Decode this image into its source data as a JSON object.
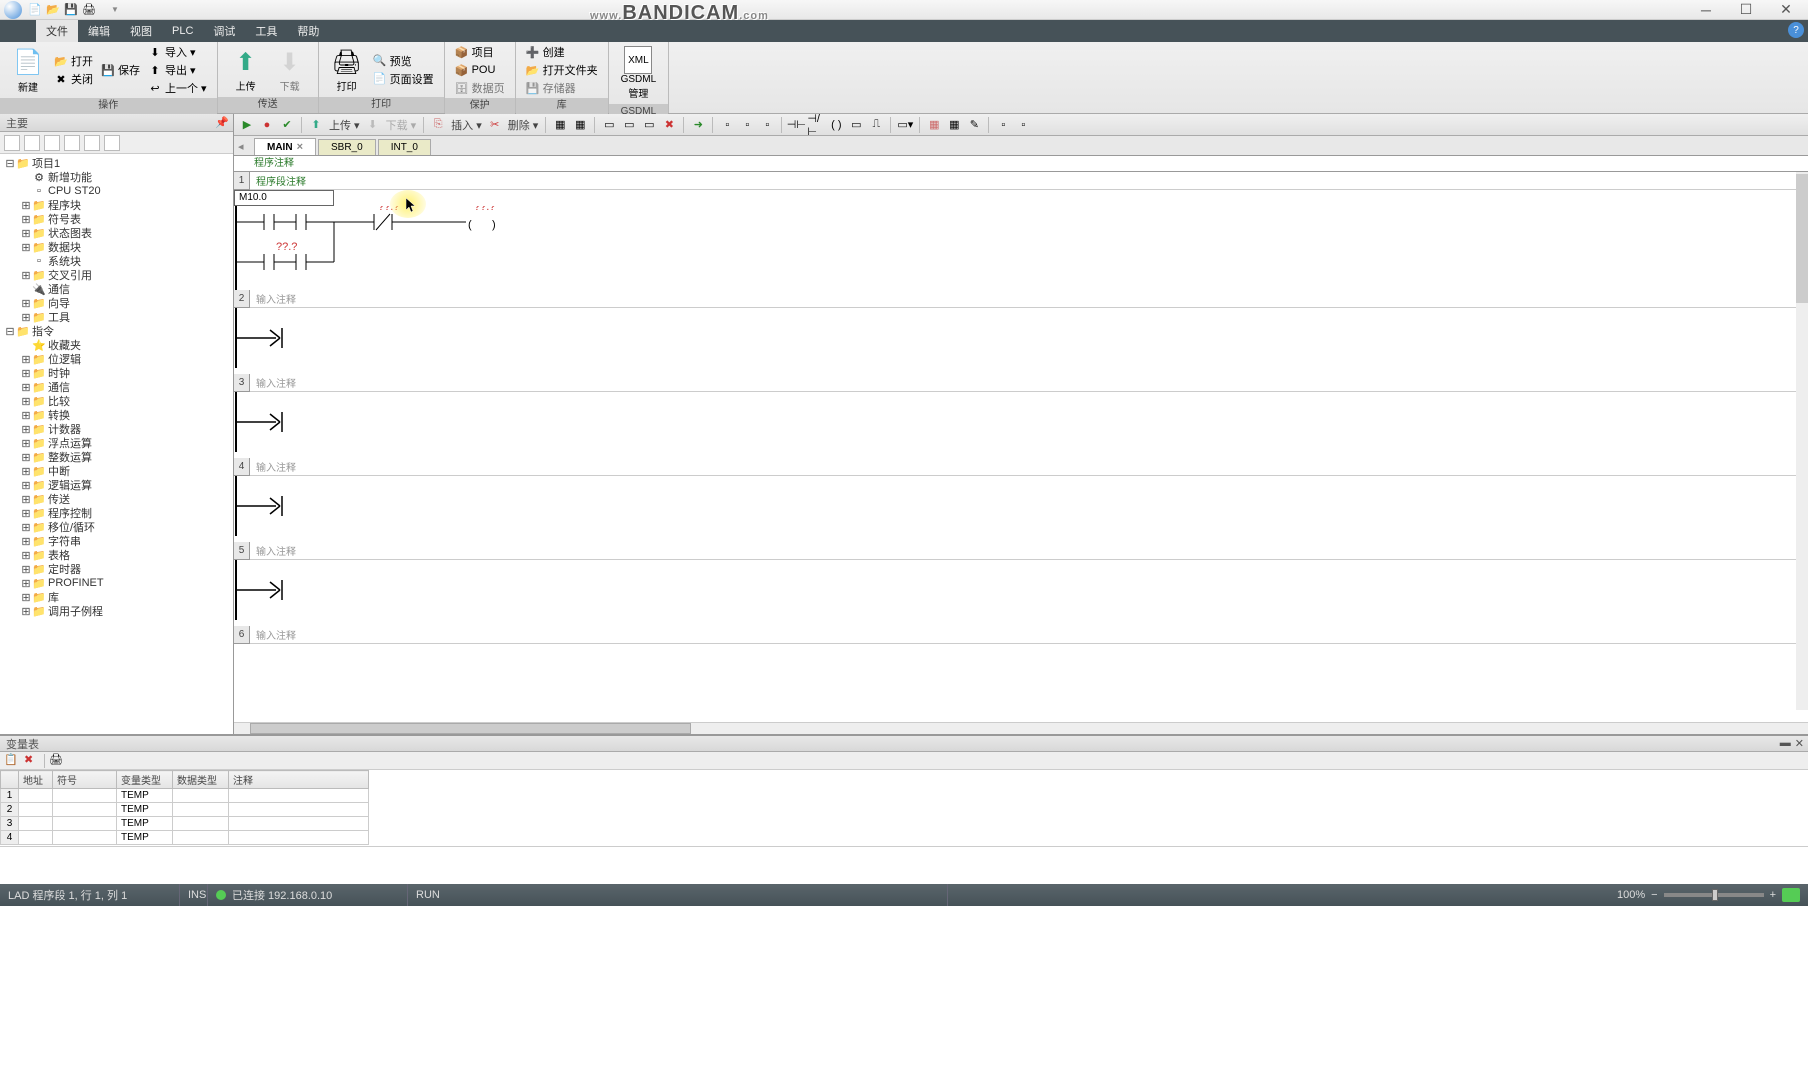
{
  "watermark": {
    "prefix": "www.",
    "main": "BANDICAM",
    "suffix": ".com"
  },
  "qat": [
    "new",
    "open",
    "save",
    "print"
  ],
  "titlebar": {
    "text": ""
  },
  "menu": {
    "items": [
      "文件",
      "编辑",
      "视图",
      "PLC",
      "调试",
      "工具",
      "帮助"
    ],
    "active_index": 0
  },
  "ribbon": {
    "groups": [
      {
        "label": "操作",
        "big": [
          {
            "icon": "📄",
            "label": "新建"
          }
        ],
        "cols": [
          [
            {
              "icon": "📂",
              "label": "打开"
            },
            {
              "icon": "✖",
              "label": "关闭"
            }
          ],
          [
            {
              "icon": "💾",
              "label": "保存",
              "dd": true
            }
          ],
          [
            {
              "icon": "⬇",
              "label": "导入 ▾"
            },
            {
              "icon": "⬆",
              "label": "导出 ▾"
            },
            {
              "icon": "↩",
              "label": "上一个 ▾"
            }
          ]
        ]
      },
      {
        "label": "传送",
        "big": [
          {
            "icon": "⬆",
            "label": "上传",
            "color": "#3a8"
          },
          {
            "icon": "⬇",
            "label": "下载",
            "color": "#bbb",
            "disabled": true
          }
        ]
      },
      {
        "label": "打印",
        "big": [
          {
            "icon": "🖨",
            "label": "打印"
          }
        ],
        "cols": [
          [
            {
              "icon": "🔍",
              "label": "预览"
            },
            {
              "icon": "📄",
              "label": "页面设置"
            }
          ]
        ]
      },
      {
        "label": "保护",
        "cols": [
          [
            {
              "icon": "📦",
              "label": "项目"
            },
            {
              "icon": "📦",
              "label": "POU"
            },
            {
              "icon": "🗄",
              "label": "数据页",
              "disabled": true
            }
          ]
        ]
      },
      {
        "label": "库",
        "cols": [
          [
            {
              "icon": "➕",
              "label": "创建"
            },
            {
              "icon": "📂",
              "label": "打开文件夹"
            },
            {
              "icon": "💾",
              "label": "存储器",
              "disabled": true
            }
          ]
        ]
      },
      {
        "label": "GSDML",
        "big": [
          {
            "icon": "XML",
            "label": "GSDML\n管理",
            "xml": true
          }
        ]
      }
    ]
  },
  "tree": {
    "title": "主要",
    "toolbar_count": 6,
    "nodes": [
      {
        "d": 0,
        "t": "-",
        "i": "📁",
        "l": "项目1"
      },
      {
        "d": 1,
        "t": " ",
        "i": "⚙",
        "l": "新增功能"
      },
      {
        "d": 1,
        "t": " ",
        "i": "▫",
        "l": "CPU ST20"
      },
      {
        "d": 1,
        "t": "+",
        "i": "📁",
        "l": "程序块"
      },
      {
        "d": 1,
        "t": "+",
        "i": "📁",
        "l": "符号表"
      },
      {
        "d": 1,
        "t": "+",
        "i": "📁",
        "l": "状态图表"
      },
      {
        "d": 1,
        "t": "+",
        "i": "📁",
        "l": "数据块"
      },
      {
        "d": 1,
        "t": " ",
        "i": "▫",
        "l": "系统块"
      },
      {
        "d": 1,
        "t": "+",
        "i": "📁",
        "l": "交叉引用"
      },
      {
        "d": 1,
        "t": " ",
        "i": "🔌",
        "l": "通信"
      },
      {
        "d": 1,
        "t": "+",
        "i": "📁",
        "l": "向导"
      },
      {
        "d": 1,
        "t": "+",
        "i": "📁",
        "l": "工具"
      },
      {
        "d": 0,
        "t": "-",
        "i": "📁",
        "l": "指令"
      },
      {
        "d": 1,
        "t": " ",
        "i": "⭐",
        "l": "收藏夹"
      },
      {
        "d": 1,
        "t": "+",
        "i": "📁",
        "l": "位逻辑"
      },
      {
        "d": 1,
        "t": "+",
        "i": "📁",
        "l": "时钟"
      },
      {
        "d": 1,
        "t": "+",
        "i": "📁",
        "l": "通信"
      },
      {
        "d": 1,
        "t": "+",
        "i": "📁",
        "l": "比较"
      },
      {
        "d": 1,
        "t": "+",
        "i": "📁",
        "l": "转换"
      },
      {
        "d": 1,
        "t": "+",
        "i": "📁",
        "l": "计数器"
      },
      {
        "d": 1,
        "t": "+",
        "i": "📁",
        "l": "浮点运算"
      },
      {
        "d": 1,
        "t": "+",
        "i": "📁",
        "l": "整数运算"
      },
      {
        "d": 1,
        "t": "+",
        "i": "📁",
        "l": "中断"
      },
      {
        "d": 1,
        "t": "+",
        "i": "📁",
        "l": "逻辑运算"
      },
      {
        "d": 1,
        "t": "+",
        "i": "📁",
        "l": "传送"
      },
      {
        "d": 1,
        "t": "+",
        "i": "📁",
        "l": "程序控制"
      },
      {
        "d": 1,
        "t": "+",
        "i": "📁",
        "l": "移位/循环"
      },
      {
        "d": 1,
        "t": "+",
        "i": "📁",
        "l": "字符串"
      },
      {
        "d": 1,
        "t": "+",
        "i": "📁",
        "l": "表格"
      },
      {
        "d": 1,
        "t": "+",
        "i": "📁",
        "l": "定时器"
      },
      {
        "d": 1,
        "t": "+",
        "i": "📁",
        "l": "PROFINET"
      },
      {
        "d": 1,
        "t": "+",
        "i": "📁",
        "l": "库"
      },
      {
        "d": 1,
        "t": "+",
        "i": "📁",
        "l": "调用子例程"
      }
    ]
  },
  "editor_toolbar": {
    "items": [
      {
        "type": "btn",
        "name": "run",
        "glyph": "▶",
        "color": "#2a8a2a"
      },
      {
        "type": "btn",
        "name": "stop",
        "glyph": "●",
        "color": "#c33"
      },
      {
        "type": "btn",
        "name": "compile",
        "glyph": "✔",
        "color": "#2a8a2a"
      },
      {
        "type": "sep"
      },
      {
        "type": "btn",
        "name": "upload-arrow",
        "glyph": "⬆",
        "color": "#3a8"
      },
      {
        "type": "text",
        "label": "上传",
        "dd": true
      },
      {
        "type": "btn",
        "name": "download-arrow",
        "glyph": "⬇",
        "color": "#bbb"
      },
      {
        "type": "text",
        "label": "下载",
        "dd": true,
        "disabled": true
      },
      {
        "type": "sep"
      },
      {
        "type": "btn",
        "name": "insert-icon",
        "glyph": "⎘",
        "color": "#c66"
      },
      {
        "type": "text",
        "label": "插入",
        "dd": true
      },
      {
        "type": "btn",
        "name": "delete-icon",
        "glyph": "✂",
        "color": "#c33"
      },
      {
        "type": "text",
        "label": "删除",
        "dd": true
      },
      {
        "type": "sep"
      },
      {
        "type": "btn",
        "name": "tb1",
        "glyph": "▦"
      },
      {
        "type": "btn",
        "name": "tb2",
        "glyph": "▦"
      },
      {
        "type": "sep"
      },
      {
        "type": "btn",
        "name": "tb3",
        "glyph": "▭"
      },
      {
        "type": "btn",
        "name": "tb4",
        "glyph": "▭"
      },
      {
        "type": "btn",
        "name": "tb5",
        "glyph": "▭"
      },
      {
        "type": "btn",
        "name": "tb6",
        "glyph": "✖",
        "color": "#c33"
      },
      {
        "type": "sep"
      },
      {
        "type": "btn",
        "name": "tb7",
        "glyph": "➜",
        "color": "#2a8a2a"
      },
      {
        "type": "sep"
      },
      {
        "type": "btn",
        "name": "tb8",
        "glyph": "▫"
      },
      {
        "type": "btn",
        "name": "tb9",
        "glyph": "▫"
      },
      {
        "type": "btn",
        "name": "tb10",
        "glyph": "▫"
      },
      {
        "type": "sep"
      },
      {
        "type": "btn",
        "name": "contact-no",
        "glyph": "⊣⊢"
      },
      {
        "type": "btn",
        "name": "contact-nc",
        "glyph": "⊣/⊢"
      },
      {
        "type": "btn",
        "name": "coil",
        "glyph": "( )"
      },
      {
        "type": "btn",
        "name": "box",
        "glyph": "▭"
      },
      {
        "type": "btn",
        "name": "branch",
        "glyph": "⎍"
      },
      {
        "type": "sep"
      },
      {
        "type": "btn",
        "name": "tb-a",
        "glyph": "▭",
        "dd": true
      },
      {
        "type": "sep"
      },
      {
        "type": "btn",
        "name": "tb-b",
        "glyph": "▦",
        "color": "#c66"
      },
      {
        "type": "btn",
        "name": "tb-c",
        "glyph": "▦"
      },
      {
        "type": "btn",
        "name": "tb-d",
        "glyph": "✎"
      },
      {
        "type": "sep"
      },
      {
        "type": "btn",
        "name": "tb-e",
        "glyph": "▫"
      },
      {
        "type": "btn",
        "name": "tb-f",
        "glyph": "▫"
      }
    ]
  },
  "tabs": [
    {
      "label": "MAIN",
      "active": true,
      "close": true
    },
    {
      "label": "SBR_0"
    },
    {
      "label": "INT_0"
    }
  ],
  "program_comment": "程序注释",
  "networks": [
    {
      "num": "1",
      "comment": "程序段注释",
      "green": true,
      "has_addr": true,
      "addr": "M10.0",
      "kind": "full"
    },
    {
      "num": "2",
      "comment": "输入注释",
      "kind": "empty"
    },
    {
      "num": "3",
      "comment": "输入注释",
      "kind": "empty"
    },
    {
      "num": "4",
      "comment": "输入注释",
      "kind": "empty"
    },
    {
      "num": "5",
      "comment": "输入注释",
      "kind": "empty"
    },
    {
      "num": "6",
      "comment": "输入注释",
      "kind": "stub"
    }
  ],
  "unk_label": "??.?",
  "var_panel": {
    "title": "变量表",
    "headers": [
      "",
      "地址",
      "符号",
      "变量类型",
      "数据类型",
      "注释"
    ],
    "rows": [
      {
        "n": "1",
        "type": "TEMP"
      },
      {
        "n": "2",
        "type": "TEMP"
      },
      {
        "n": "3",
        "type": "TEMP"
      },
      {
        "n": "4",
        "type": "TEMP"
      }
    ]
  },
  "status": {
    "pos": "LAD 程序段 1, 行 1, 列 1",
    "ins": "INS",
    "conn": "已连接 192.168.0.10",
    "run": "RUN",
    "zoom": "100%"
  }
}
